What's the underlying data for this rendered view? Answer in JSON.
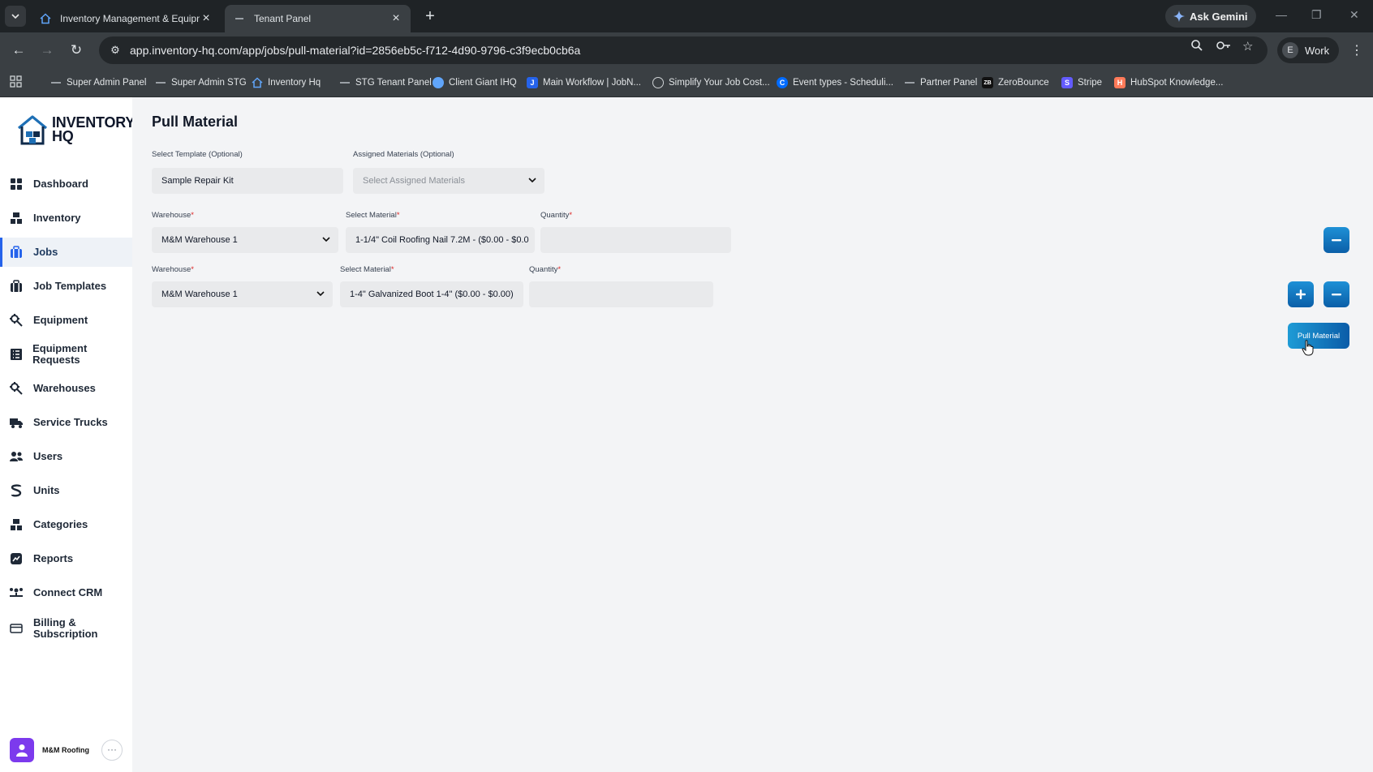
{
  "browser": {
    "tabs": [
      {
        "title": "Inventory Management & Equipm",
        "active": false
      },
      {
        "title": "Tenant Panel",
        "active": true
      }
    ],
    "ask_gemini": "Ask Gemini",
    "url": "app.inventory-hq.com/app/jobs/pull-material?id=2856eb5c-f712-4d90-9796-c3f9ecb0cb6a",
    "profile_initial": "E",
    "profile_label": "Work",
    "bookmarks": [
      {
        "label": "Super Admin Panel",
        "icon": "dash-icon",
        "color": "#5f6368"
      },
      {
        "label": "Super Admin STG",
        "icon": "dash-icon",
        "color": "#5f6368"
      },
      {
        "label": "Inventory Hq",
        "icon": "house-icon",
        "color": "#3b82f6"
      },
      {
        "label": "STG Tenant Panel",
        "icon": "dash-icon",
        "color": "#5f6368"
      },
      {
        "label": "Client Giant IHQ",
        "icon": "circle-icon",
        "color": "#60a5fa"
      },
      {
        "label": "Main Workflow | JobN...",
        "icon": "jobnimbus-icon",
        "color": "#2563eb"
      },
      {
        "label": "Simplify Your Job Cost...",
        "icon": "globe-icon",
        "color": "#6b7280"
      },
      {
        "label": "Event types - Scheduli...",
        "icon": "calendly-icon",
        "color": "#006bff"
      },
      {
        "label": "Partner Panel",
        "icon": "dash-icon",
        "color": "#5f6368"
      },
      {
        "label": "ZeroBounce",
        "icon": "zb-icon",
        "color": "#1f2937"
      },
      {
        "label": "Stripe",
        "icon": "stripe-icon",
        "color": "#635bff"
      },
      {
        "label": "HubSpot Knowledge...",
        "icon": "hubspot-icon",
        "color": "#ff7a59"
      }
    ]
  },
  "app": {
    "logo": {
      "line1": "INVENTORY",
      "line2": "HQ"
    },
    "nav": [
      {
        "label": "Dashboard",
        "icon": "dashboard-icon",
        "active": false
      },
      {
        "label": "Inventory",
        "icon": "inventory-icon",
        "active": false
      },
      {
        "label": "Jobs",
        "icon": "jobs-icon",
        "active": true
      },
      {
        "label": "Job Templates",
        "icon": "job-templates-icon",
        "active": false
      },
      {
        "label": "Equipment",
        "icon": "equipment-icon",
        "active": false
      },
      {
        "label": "Equipment Requests",
        "icon": "equipment-requests-icon",
        "active": false
      },
      {
        "label": "Warehouses",
        "icon": "warehouses-icon",
        "active": false
      },
      {
        "label": "Service Trucks",
        "icon": "truck-icon",
        "active": false
      },
      {
        "label": "Users",
        "icon": "users-icon",
        "active": false
      },
      {
        "label": "Units",
        "icon": "units-icon",
        "active": false
      },
      {
        "label": "Categories",
        "icon": "categories-icon",
        "active": false
      },
      {
        "label": "Reports",
        "icon": "reports-icon",
        "active": false
      },
      {
        "label": "Connect CRM",
        "icon": "crm-icon",
        "active": false
      },
      {
        "label": "Billing &\nSubscription",
        "icon": "billing-icon",
        "active": false
      }
    ],
    "user": {
      "name": "M&M Roofing",
      "more": "···"
    },
    "page": {
      "title": "Pull Material",
      "template_label": "Select Template (Optional)",
      "template_value": "Sample Repair Kit",
      "assigned_label": "Assigned Materials (Optional)",
      "assigned_placeholder": "Select Assigned Materials",
      "rows": [
        {
          "warehouse_label": "Warehouse",
          "warehouse_value": "M&M Warehouse 1",
          "material_label": "Select Material",
          "material_value": "1-1/4\" Coil Roofing Nail 7.2M - ($0.00 - $0.0",
          "quantity_label": "Quantity",
          "quantity_value": ""
        },
        {
          "warehouse_label": "Warehouse",
          "warehouse_value": "M&M Warehouse 1",
          "material_label": "Select Material",
          "material_value": "1-4\" Galvanized Boot 1-4\" ($0.00 - $0.00)",
          "quantity_label": "Quantity",
          "quantity_value": ""
        }
      ],
      "required_mark": "*",
      "pull_button": "Pull Material"
    }
  }
}
